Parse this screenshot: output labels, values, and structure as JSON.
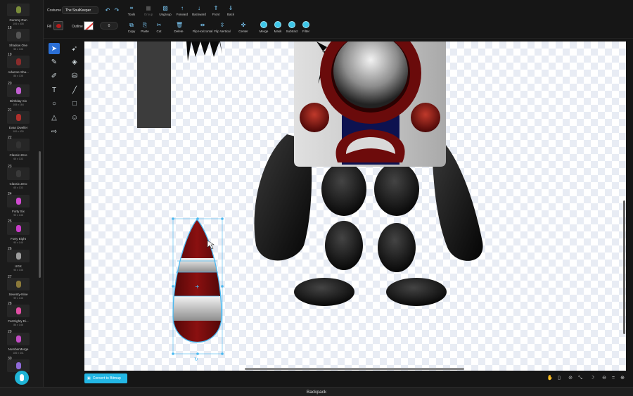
{
  "costumes": [
    {
      "num": "",
      "name": "Gummy Run",
      "size": "106 x 408",
      "color": "#7a8c3a"
    },
    {
      "num": "18",
      "name": "Shadow One",
      "size": "55 x 136",
      "color": "#555555"
    },
    {
      "num": "19",
      "name": "Adverse Sha...",
      "size": "86 x 136",
      "color": "#8a2c2c"
    },
    {
      "num": "20",
      "name": "Birthday Six",
      "size": "108 x 164",
      "color": "#c25fd1"
    },
    {
      "num": "21",
      "name": "Evan Dweller",
      "size": "100 x 430",
      "color": "#b0302c"
    },
    {
      "num": "22",
      "name": "Classic Zero",
      "size": "65 x 133",
      "color": "#333333"
    },
    {
      "num": "23",
      "name": "Classic Zero",
      "size": "65 x 133",
      "color": "#3a3a3a"
    },
    {
      "num": "24",
      "name": "Forty Six",
      "size": "90 x 146",
      "color": "#d04bd0"
    },
    {
      "num": "25",
      "name": "Forty Eight",
      "size": "90 x 146",
      "color": "#c83cc8"
    },
    {
      "num": "26",
      "name": "UGK",
      "size": "95 x 146",
      "color": "#9e9e9e"
    },
    {
      "num": "27",
      "name": "Seventy-Nine",
      "size": "99 x 146",
      "color": "#8c7a3a"
    },
    {
      "num": "28",
      "name": "Fat Eighty Ei...",
      "size": "86 x 146",
      "color": "#e24fa4"
    },
    {
      "num": "29",
      "name": "NumberMerge",
      "size": "186 x 341",
      "color": "#c24cc4"
    },
    {
      "num": "30",
      "name": "",
      "size": "",
      "color": "#8f6ad8"
    }
  ],
  "toolbar": {
    "costume_label": "Costume",
    "costume_name": "The SoulKeeper",
    "buttons_top": [
      {
        "label": "Tools",
        "icon": "tools-icon",
        "glyph": "⌗",
        "dim": false
      },
      {
        "label": "Group",
        "icon": "group-icon",
        "glyph": "▦",
        "dim": true
      },
      {
        "label": "Ungroup",
        "icon": "ungroup-icon",
        "glyph": "▨",
        "dim": false
      },
      {
        "label": "Forward",
        "icon": "forward-icon",
        "glyph": "↑",
        "dim": false
      },
      {
        "label": "Backward",
        "icon": "backward-icon",
        "glyph": "↓",
        "dim": false
      },
      {
        "label": "Front",
        "icon": "front-icon",
        "glyph": "⇑",
        "dim": false
      },
      {
        "label": "Back",
        "icon": "back-icon",
        "glyph": "⇓",
        "dim": false
      }
    ],
    "fill_label": "Fill",
    "outline_label": "Outline",
    "outline_width": "0",
    "buttons_bottom": [
      {
        "label": "Copy",
        "icon": "copy-icon",
        "glyph": "⧉"
      },
      {
        "label": "Paste",
        "icon": "paste-icon",
        "glyph": "⎘"
      },
      {
        "label": "Cut",
        "icon": "cut-icon",
        "glyph": "✂"
      },
      {
        "label": "Delete",
        "icon": "delete-icon",
        "glyph": "🗑"
      },
      {
        "label": "Flip Horizontal",
        "icon": "flip-horizontal-icon",
        "glyph": "⇹"
      },
      {
        "label": "Flip Vertical",
        "icon": "flip-vertical-icon",
        "glyph": "⇳"
      },
      {
        "label": "Center",
        "icon": "center-icon",
        "glyph": "✜"
      }
    ],
    "boolean_ops": [
      "Merge",
      "Mask",
      "Subtract",
      "Filter"
    ]
  },
  "bottom": {
    "convert_label": "Convert to Bitmap",
    "backpack_label": "Backpack"
  },
  "accent_color": "#23b7e5"
}
